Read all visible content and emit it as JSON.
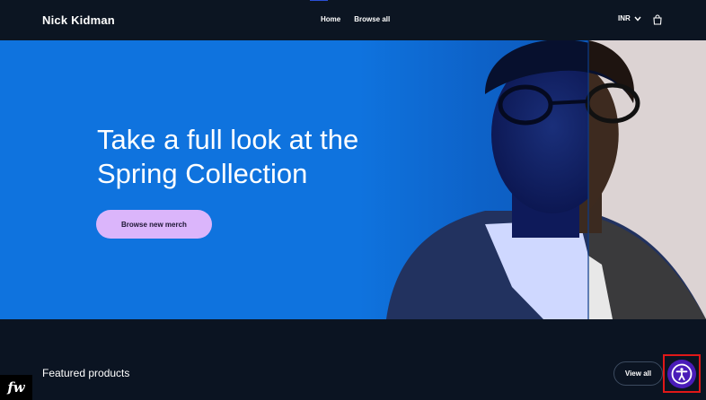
{
  "header": {
    "brand": "Nick Kidman",
    "nav": {
      "home": "Home",
      "browse_all": "Browse all"
    },
    "currency": "INR"
  },
  "hero": {
    "title_line1": "Take a full look at the",
    "title_line2": "Spring Collection",
    "cta": "Browse new merch"
  },
  "featured": {
    "title": "Featured products",
    "view_all": "View all"
  },
  "badge": {
    "label": "fw"
  },
  "colors": {
    "page_bg": "#0b1422",
    "hero_blue": "#0f73de",
    "cta_bg": "#dbb5fb",
    "accessibility": "#4a1cb8",
    "highlight": "#e01818"
  },
  "icons": {
    "currency": "chevron-down-icon",
    "cart": "bag-icon",
    "accessibility": "accessibility-icon"
  }
}
